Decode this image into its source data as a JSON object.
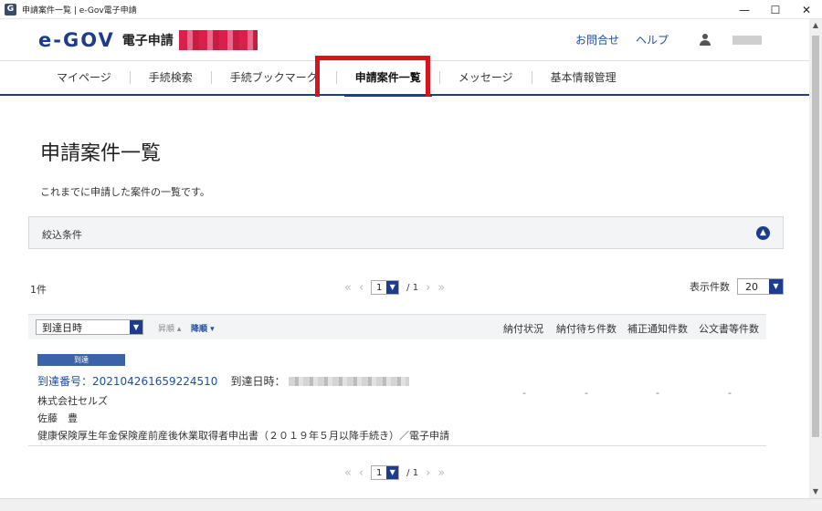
{
  "window": {
    "title": "申請案件一覧 | e-Gov電子申請",
    "minimize": "—",
    "maximize": "☐",
    "close": "✕"
  },
  "header": {
    "logo_mark": "e-GOV",
    "logo_sub": "電子申請",
    "links": [
      "お問合せ",
      "ヘルプ"
    ]
  },
  "nav": {
    "items": [
      "マイページ",
      "手続検索",
      "手続ブックマーク",
      "申請案件一覧",
      "メッセージ",
      "基本情報管理"
    ],
    "active_index": 3
  },
  "page": {
    "title": "申請案件一覧",
    "description": "これまでに申請した案件の一覧です。"
  },
  "filter": {
    "label": "絞込条件",
    "toggle_icon": "chevron-up-icon"
  },
  "results": {
    "count": "1件",
    "pager": {
      "first": "«",
      "prev": "‹",
      "page": "1",
      "total": "/ 1",
      "next": "›",
      "last": "»"
    },
    "per_page_label": "表示件数",
    "per_page_value": "20"
  },
  "table": {
    "sort_value": "到達日時",
    "sort_asc": "昇順 ▴",
    "sort_desc": "降順 ▾",
    "columns": [
      "納付状況",
      "納付待ち件数",
      "補正通知件数",
      "公文書等件数"
    ]
  },
  "row": {
    "badge": "到達",
    "arrival_number": "到達番号：202104261659224510",
    "arrival_date_label": "到達日時：",
    "company": "株式会社セルズ",
    "person": "佐藤　豊",
    "procedure": "健康保険厚生年金保険産前産後休業取得者申出書（２０１９年５月以降手続き）／電子申請",
    "cells": [
      "-",
      "-",
      "-",
      "-"
    ]
  },
  "colors": {
    "accent": "#1e3c8c",
    "highlight": "#d7141e",
    "link": "#1e4ea0"
  }
}
